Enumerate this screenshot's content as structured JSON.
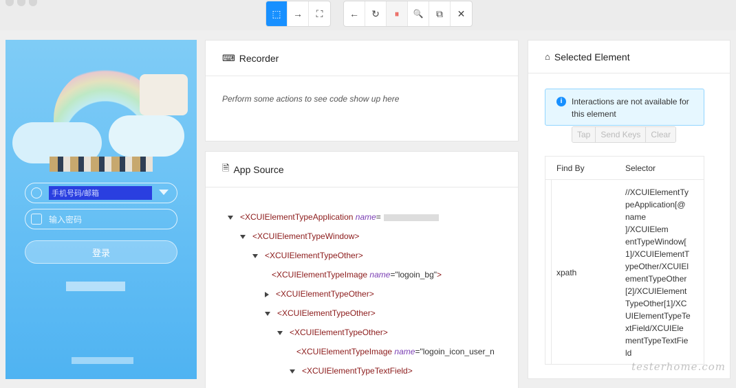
{
  "toolbar": {
    "group1": [
      {
        "name": "select-elements",
        "icon": "cursor-select-icon",
        "glyph": "⬚",
        "active": true
      },
      {
        "name": "swipe-by-coordinates",
        "icon": "arrow-right-icon",
        "glyph": "→"
      },
      {
        "name": "tap-by-coordinates",
        "icon": "crop-scan-icon",
        "glyph": "⛶"
      }
    ],
    "group2": [
      {
        "name": "back",
        "icon": "arrow-left-icon",
        "glyph": "←"
      },
      {
        "name": "refresh",
        "icon": "refresh-icon",
        "glyph": "↻"
      },
      {
        "name": "pause-recording",
        "icon": "pause-icon",
        "glyph": "⏸",
        "paused": true
      },
      {
        "name": "search-elements",
        "icon": "search-icon",
        "glyph": "🔍"
      },
      {
        "name": "copy-xml",
        "icon": "copy-icon",
        "glyph": "⧉"
      },
      {
        "name": "quit-session",
        "icon": "close-icon",
        "glyph": "✕"
      }
    ]
  },
  "device": {
    "login_button": "登录",
    "account_placeholder": "手机号码/邮箱",
    "password_placeholder": "输入密码"
  },
  "recorder": {
    "title": "Recorder",
    "empty_message": "Perform some actions to see code show up here"
  },
  "app_source": {
    "title": "App Source",
    "nodes": [
      {
        "depth": 0,
        "arrow": "down",
        "tag": "XCUIElementTypeApplication",
        "attr": "name",
        "val": "",
        "redacted": true
      },
      {
        "depth": 1,
        "arrow": "down",
        "tag": "XCUIElementTypeWindow"
      },
      {
        "depth": 2,
        "arrow": "down",
        "tag": "XCUIElementTypeOther"
      },
      {
        "depth": 3,
        "arrow": "none",
        "tag": "XCUIElementTypeImage",
        "attr": "name",
        "val": "\"logoin_bg\""
      },
      {
        "depth": 3,
        "arrow": "right",
        "tag": "XCUIElementTypeOther"
      },
      {
        "depth": 3,
        "arrow": "down",
        "tag": "XCUIElementTypeOther"
      },
      {
        "depth": 4,
        "arrow": "down",
        "tag": "XCUIElementTypeOther"
      },
      {
        "depth": 5,
        "arrow": "none",
        "tag": "XCUIElementTypeImage",
        "attr": "name",
        "val": "\"logoin_icon_user_n"
      },
      {
        "depth": 5,
        "arrow": "down",
        "tag": "XCUIElementTypeTextField"
      }
    ]
  },
  "selected_element": {
    "title": "Selected Element",
    "alert": "Interactions are not available for this element",
    "buttons": [
      "Tap",
      "Send Keys",
      "Clear"
    ],
    "table": {
      "col_find_by": "Find By",
      "col_selector": "Selector",
      "find_by": "xpath",
      "selector_lines": [
        "//XCUIElementTy",
        "peApplication[@",
        "name",
        "]/XCUIElem",
        "entTypeWindow[",
        "1]/XCUIElementT",
        "ypeOther/XCUIEl",
        "ementTypeOther",
        "[2]/XCUIElement",
        "TypeOther[1]/XC",
        "UIElementTypeTe",
        "xtField/XCUIEle",
        "mentTypeTextFie",
        "ld"
      ]
    }
  },
  "watermark": "testerhome.com"
}
